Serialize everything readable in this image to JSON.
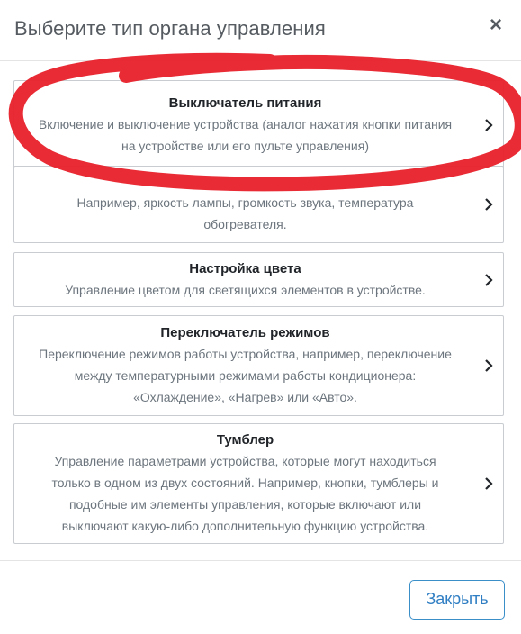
{
  "header": {
    "title": "Выберите тип органа управления",
    "close_icon": "×"
  },
  "options": [
    {
      "title": "Выключатель питания",
      "description": "Включение и выключение устройства (аналог нажатия кнопки питания на устройстве или его пульте управления)"
    },
    {
      "title": "",
      "description": "Например, яркость лампы, громкость звука, температура обогревателя."
    },
    {
      "title": "Настройка цвета",
      "description": "Управление цветом для светящихся элементов в устройстве."
    },
    {
      "title": "Переключатель режимов",
      "description": "Переключение режимов работы устройства, например, переключение между температурными режимами работы кондиционера: «Охлаждение», «Нагрев» или «Авто»."
    },
    {
      "title": "Тумблер",
      "description": "Управление параметрами устройства, которые могут находиться только в одном из двух состояний. Например, кнопки, тумблеры и подобные им элементы управления, которые включают или выключают какую-либо дополнительную функцию устройства."
    }
  ],
  "footer": {
    "close_label": "Закрыть"
  },
  "colors": {
    "annotation": "#e8202a",
    "accent": "#2f7ec3",
    "border": "#c9cdd1"
  }
}
